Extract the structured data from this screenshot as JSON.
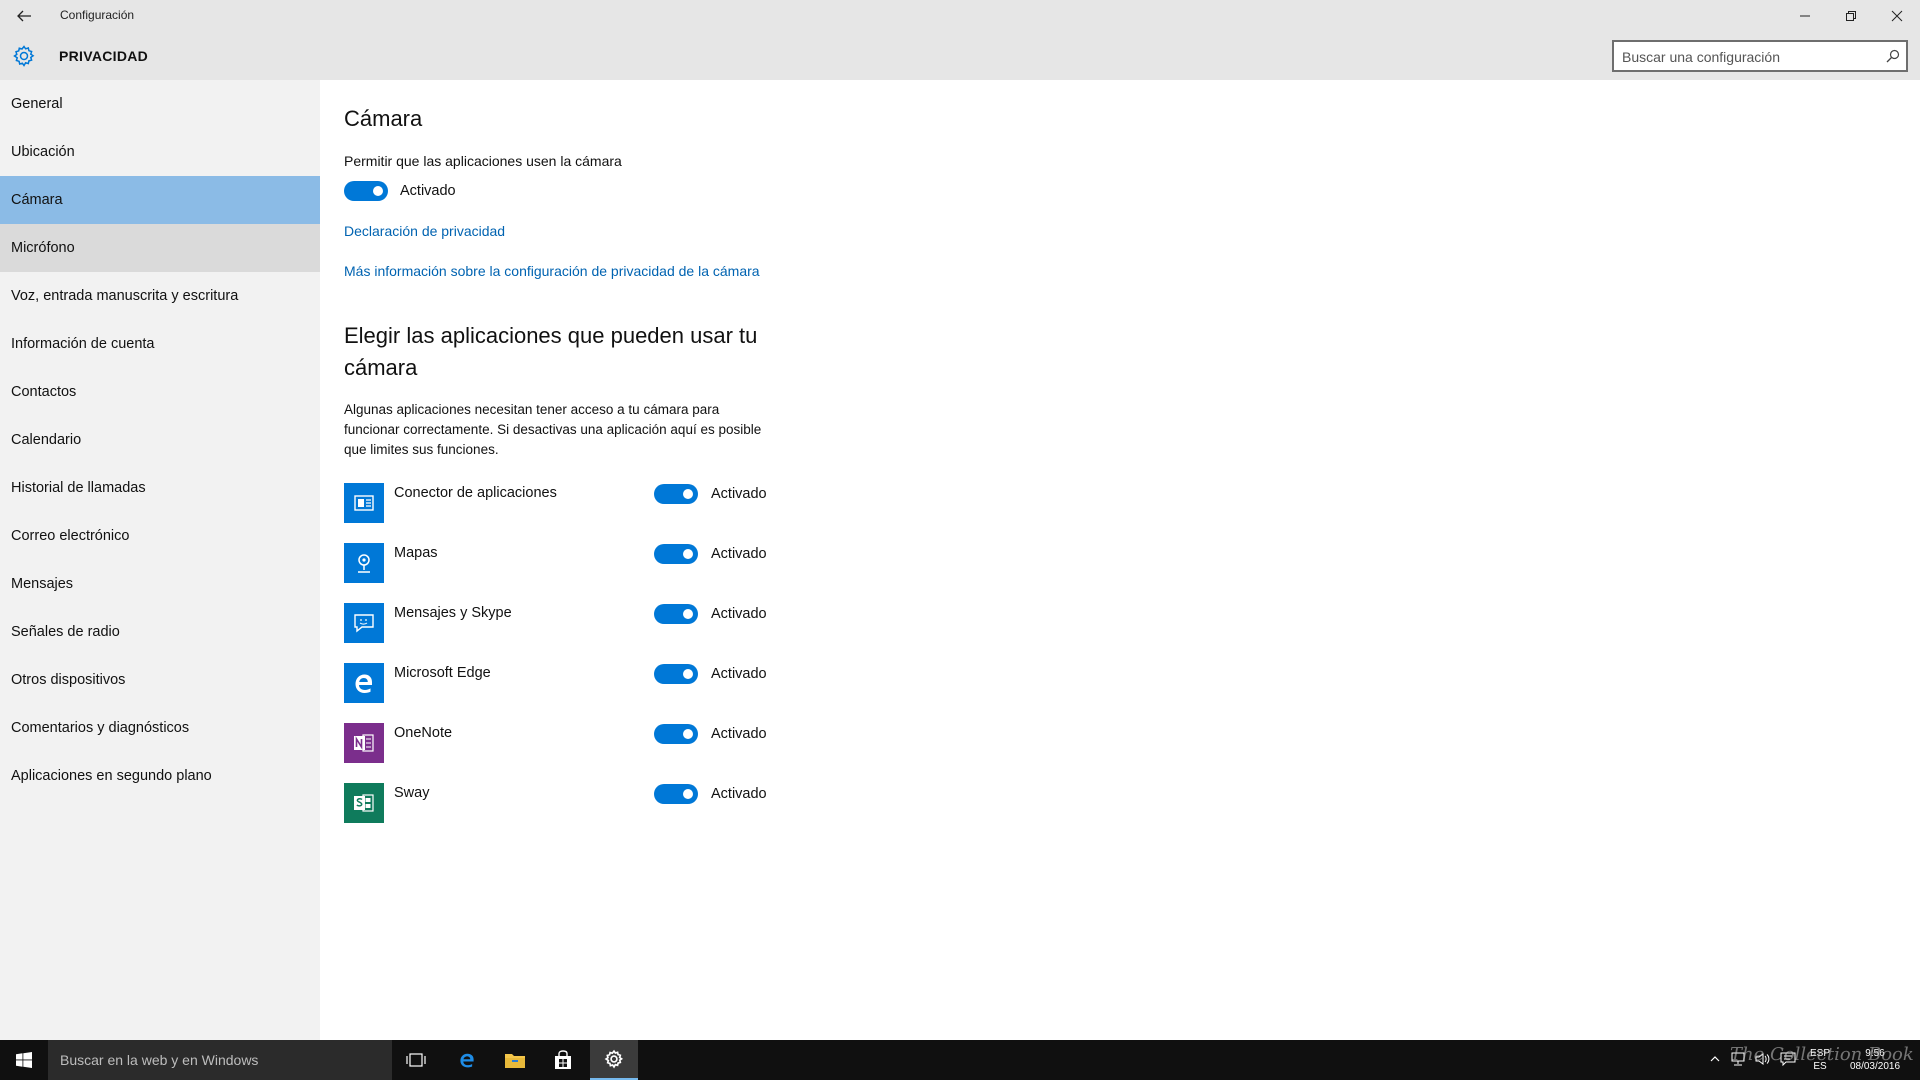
{
  "window": {
    "title": "Configuración",
    "section": "PRIVACIDAD",
    "search_placeholder": "Buscar una configuración"
  },
  "sidebar": {
    "items": [
      {
        "label": "General"
      },
      {
        "label": "Ubicación"
      },
      {
        "label": "Cámara"
      },
      {
        "label": "Micrófono"
      },
      {
        "label": "Voz, entrada manuscrita y escritura"
      },
      {
        "label": "Información de cuenta"
      },
      {
        "label": "Contactos"
      },
      {
        "label": "Calendario"
      },
      {
        "label": "Historial de llamadas"
      },
      {
        "label": "Correo electrónico"
      },
      {
        "label": "Mensajes"
      },
      {
        "label": "Señales de radio"
      },
      {
        "label": "Otros dispositivos"
      },
      {
        "label": "Comentarios y diagnósticos"
      },
      {
        "label": "Aplicaciones en segundo plano"
      }
    ],
    "selected": "Cámara",
    "hovered": "Micrófono"
  },
  "main": {
    "title": "Cámara",
    "allow_label": "Permitir que las aplicaciones usen la cámara",
    "allow_state": "Activado",
    "privacy_link": "Declaración de privacidad",
    "more_info_link": "Más información sobre la configuración de privacidad de la cámara",
    "section_title": "Elegir las aplicaciones que pueden usar tu cámara",
    "description": "Algunas aplicaciones necesitan tener acceso a tu cámara para funcionar correctamente. Si desactivas una aplicación aquí es posible que limites sus funciones.",
    "apps": [
      {
        "name": "Conector de aplicaciones",
        "state": "Activado",
        "icon": "app-connector-icon",
        "color": "#0078d7"
      },
      {
        "name": "Mapas",
        "state": "Activado",
        "icon": "maps-icon",
        "color": "#0078d7"
      },
      {
        "name": "Mensajes y Skype",
        "state": "Activado",
        "icon": "messaging-icon",
        "color": "#0078d7"
      },
      {
        "name": "Microsoft Edge",
        "state": "Activado",
        "icon": "edge-icon",
        "color": "#0078d7"
      },
      {
        "name": "OneNote",
        "state": "Activado",
        "icon": "onenote-icon",
        "color": "#7b2e8c"
      },
      {
        "name": "Sway",
        "state": "Activado",
        "icon": "sway-icon",
        "color": "#0f7b5c"
      }
    ]
  },
  "taskbar": {
    "search_placeholder": "Buscar en la web y en Windows",
    "language": "ESP",
    "language_sub": "ES",
    "time": "9:56",
    "date": "08/03/2016"
  },
  "watermark": "The Collection Book",
  "colors": {
    "accent": "#0078d7",
    "selected_nav": "#8bbbe6",
    "link": "#0063b1"
  }
}
